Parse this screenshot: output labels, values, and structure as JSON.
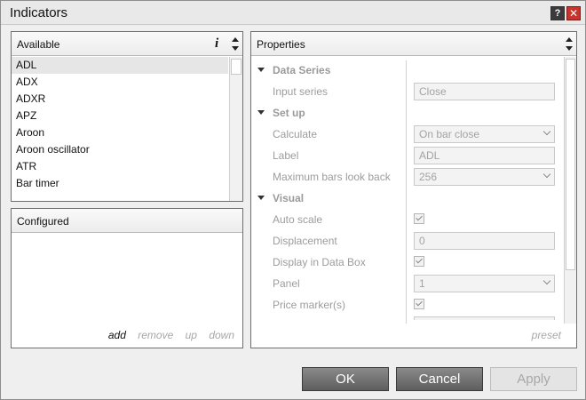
{
  "window": {
    "title": "Indicators",
    "help_glyph": "?",
    "close_glyph": "✕"
  },
  "available": {
    "title": "Available",
    "info_glyph": "i",
    "items": [
      "ADL",
      "ADX",
      "ADXR",
      "APZ",
      "Aroon",
      "Aroon oscillator",
      "ATR",
      "Bar timer"
    ],
    "selected": "ADL"
  },
  "configured": {
    "title": "Configured",
    "actions": {
      "add": "add",
      "remove": "remove",
      "up": "up",
      "down": "down"
    }
  },
  "properties": {
    "title": "Properties",
    "rows": [
      {
        "type": "category",
        "label": "Data Series"
      },
      {
        "type": "text",
        "label": "Input series",
        "value": "Close"
      },
      {
        "type": "category",
        "label": "Set up"
      },
      {
        "type": "select",
        "label": "Calculate",
        "value": "On bar close"
      },
      {
        "type": "text",
        "label": "Label",
        "value": "ADL"
      },
      {
        "type": "select",
        "label": "Maximum bars look back",
        "value": "256"
      },
      {
        "type": "category",
        "label": "Visual"
      },
      {
        "type": "check",
        "label": "Auto scale",
        "checked": true
      },
      {
        "type": "text",
        "label": "Displacement",
        "value": "0"
      },
      {
        "type": "check",
        "label": "Display in Data Box",
        "checked": true
      },
      {
        "type": "select",
        "label": "Panel",
        "value": "1"
      },
      {
        "type": "check",
        "label": "Price marker(s)",
        "checked": true
      }
    ],
    "preset": "preset"
  },
  "buttons": {
    "ok": "OK",
    "cancel": "Cancel",
    "apply": "Apply"
  }
}
